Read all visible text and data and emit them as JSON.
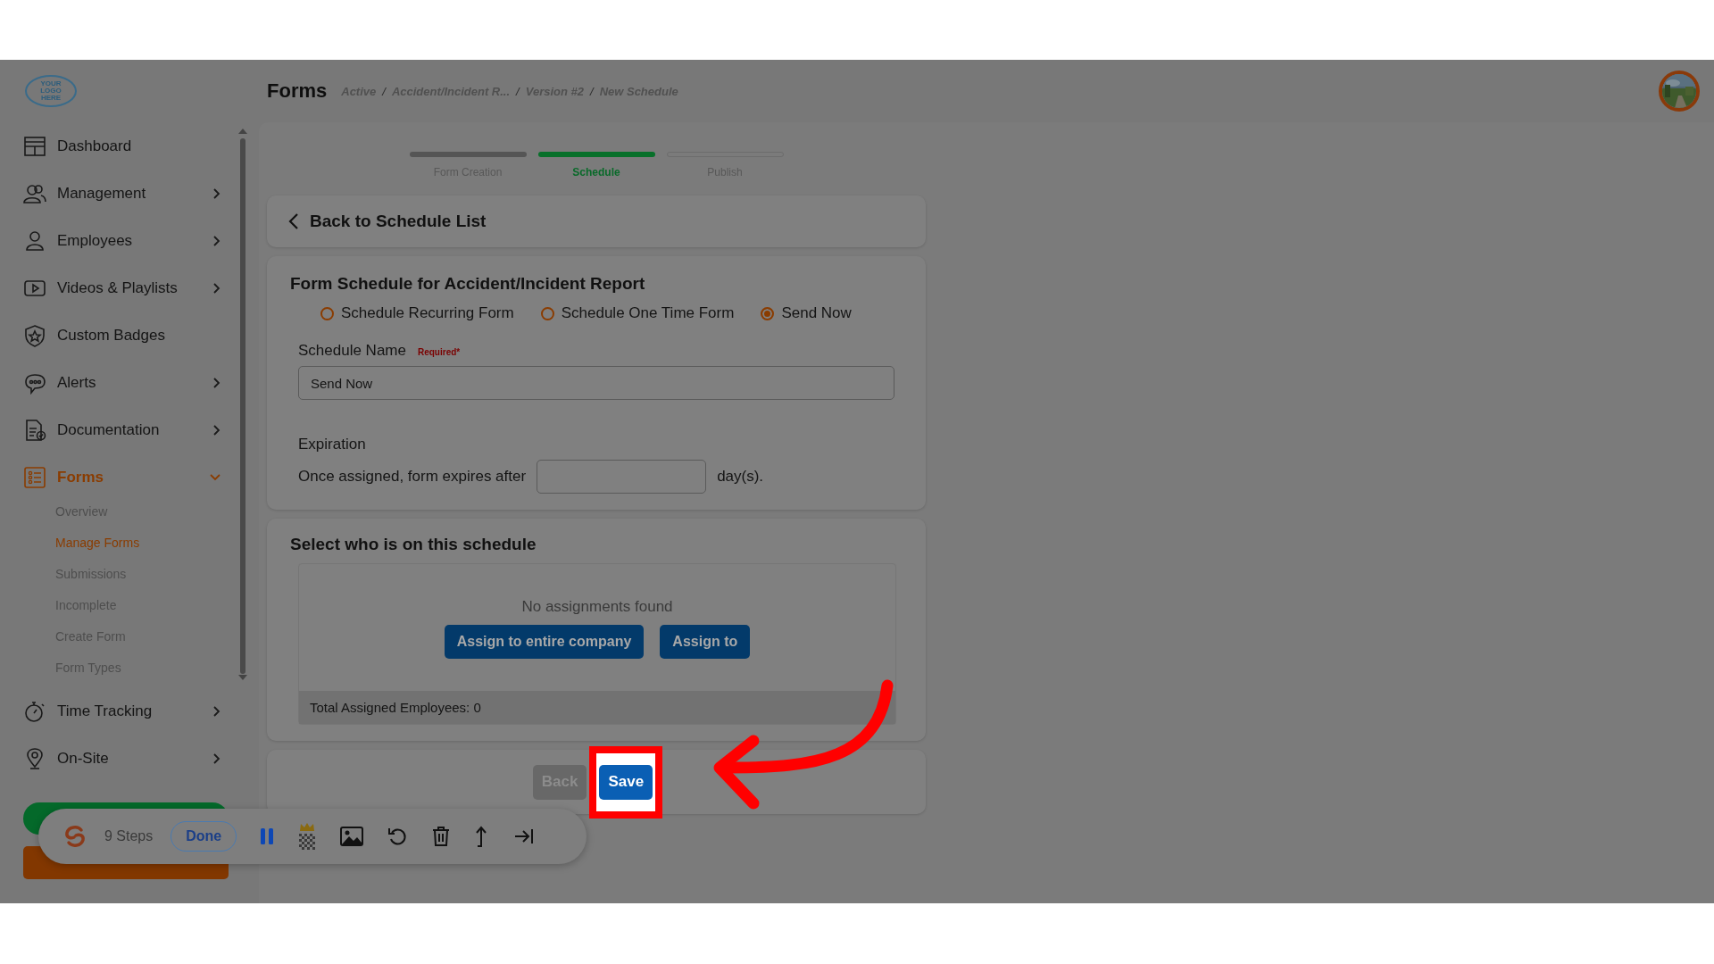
{
  "header": {
    "logo_text": "YOUR LOGO HERE",
    "title": "Forms",
    "breadcrumb": [
      {
        "kind": "crumb",
        "text": "Active"
      },
      {
        "kind": "separator",
        "text": "/"
      },
      {
        "kind": "crumb",
        "text": "Accident/Incident R..."
      },
      {
        "kind": "separator",
        "text": "/"
      },
      {
        "kind": "crumb",
        "text": "Version #2"
      },
      {
        "kind": "separator",
        "text": "/"
      },
      {
        "kind": "crumb",
        "text": "New Schedule"
      }
    ]
  },
  "sidebar": {
    "items": [
      {
        "label": "Dashboard",
        "has_submenu": false,
        "selected": false
      },
      {
        "label": "Management",
        "has_submenu": true,
        "expanded": false,
        "selected": false
      },
      {
        "label": "Employees",
        "has_submenu": true,
        "expanded": false,
        "selected": false
      },
      {
        "label": "Videos & Playlists",
        "has_submenu": true,
        "expanded": false,
        "selected": false
      },
      {
        "label": "Custom Badges",
        "has_submenu": false,
        "selected": false
      },
      {
        "label": "Alerts",
        "has_submenu": true,
        "expanded": false,
        "selected": false
      },
      {
        "label": "Documentation",
        "has_submenu": true,
        "expanded": false,
        "selected": false
      },
      {
        "label": "Forms",
        "has_submenu": true,
        "expanded": true,
        "selected": true,
        "children": [
          {
            "label": "Overview",
            "selected": false
          },
          {
            "label": "Manage Forms",
            "selected": true
          },
          {
            "label": "Submissions",
            "selected": false
          },
          {
            "label": "Incomplete",
            "selected": false
          },
          {
            "label": "Create Form",
            "selected": false
          },
          {
            "label": "Form Types",
            "selected": false
          }
        ]
      },
      {
        "label": "Time Tracking",
        "has_submenu": true,
        "expanded": false,
        "selected": false
      },
      {
        "label": "On-Site",
        "has_submenu": true,
        "expanded": false,
        "selected": false
      }
    ]
  },
  "stepper": [
    {
      "label": "Form Creation",
      "completed": true,
      "selected": false
    },
    {
      "label": "Schedule",
      "completed": false,
      "selected": true
    },
    {
      "label": "Publish",
      "completed": false,
      "selected": false
    }
  ],
  "back_link": "Back to Schedule List",
  "schedule_form": {
    "title": "Form Schedule for Accident/Incident Report",
    "radios": [
      {
        "label": "Schedule Recurring Form",
        "selected": false
      },
      {
        "label": "Schedule One Time Form",
        "selected": false
      },
      {
        "label": "Send Now",
        "selected": true
      }
    ],
    "name_label": "Schedule Name",
    "required_mark": "Required*",
    "name_value": "Send Now",
    "expiration_heading": "Expiration",
    "expiration_text": "Once assigned, form expires after",
    "expiration_suffix": "day(s)."
  },
  "assignments": {
    "title": "Select who is on this schedule",
    "empty_text": "No assignments found",
    "buttons": [
      "Assign to entire company",
      "Assign to"
    ],
    "total": "Total Assigned Employees: 0"
  },
  "footer_buttons": [
    {
      "label": "Back",
      "disabled": true,
      "highlighted": false
    },
    {
      "label": "Save",
      "disabled": false,
      "highlighted": true
    }
  ],
  "recorder": {
    "steps": "9 Steps",
    "done": "Done"
  }
}
